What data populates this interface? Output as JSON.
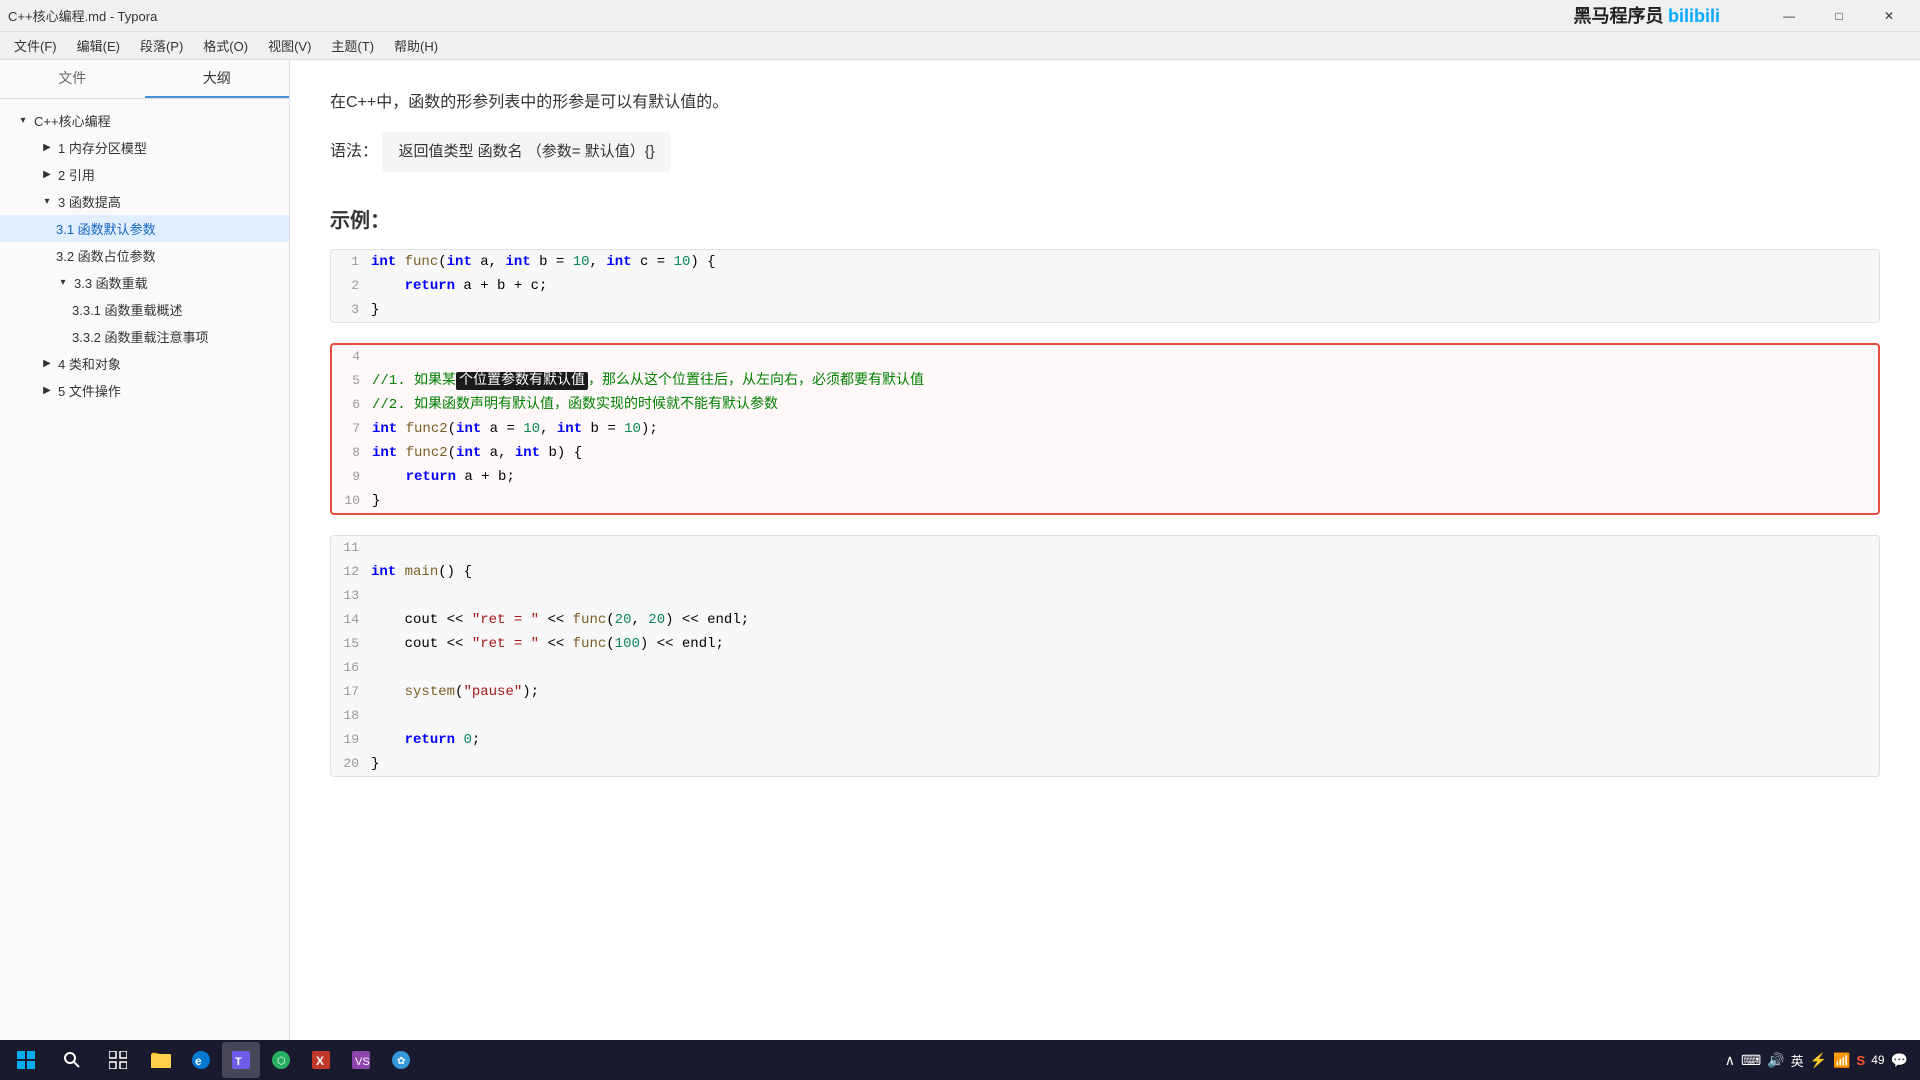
{
  "titleBar": {
    "title": "C++核心编程.md - Typora",
    "minimizeLabel": "—",
    "maximizeLabel": "□",
    "closeLabel": "✕"
  },
  "menuBar": {
    "items": [
      {
        "id": "file",
        "label": "文件(F)"
      },
      {
        "id": "edit",
        "label": "编辑(E)"
      },
      {
        "id": "paragraph",
        "label": "段落(P)"
      },
      {
        "id": "format",
        "label": "格式(O)"
      },
      {
        "id": "view",
        "label": "视图(V)"
      },
      {
        "id": "theme",
        "label": "主题(T)"
      },
      {
        "id": "help",
        "label": "帮助(H)"
      }
    ]
  },
  "sidebar": {
    "tabs": [
      {
        "id": "files",
        "label": "文件"
      },
      {
        "id": "outline",
        "label": "大纲",
        "active": true
      }
    ],
    "items": [
      {
        "id": "root",
        "label": "C++核心编程",
        "level": 0,
        "expanded": true,
        "arrow": "▾"
      },
      {
        "id": "s1",
        "label": "1 内存分区模型",
        "level": 1,
        "expanded": false,
        "arrow": "▶"
      },
      {
        "id": "s2",
        "label": "2 引用",
        "level": 1,
        "expanded": false,
        "arrow": "▶"
      },
      {
        "id": "s3",
        "label": "3 函数提高",
        "level": 1,
        "expanded": true,
        "arrow": "▾"
      },
      {
        "id": "s31",
        "label": "3.1 函数默认参数",
        "level": 2,
        "active": true
      },
      {
        "id": "s32",
        "label": "3.2 函数占位参数",
        "level": 2
      },
      {
        "id": "s33",
        "label": "3.3 函数重载",
        "level": 2,
        "expanded": true,
        "arrow": "▾"
      },
      {
        "id": "s331",
        "label": "3.3.1 函数重载概述",
        "level": 3
      },
      {
        "id": "s332",
        "label": "3.3.2 函数重载注意事项",
        "level": 3
      },
      {
        "id": "s4",
        "label": "4 类和对象",
        "level": 1,
        "expanded": false,
        "arrow": "▶"
      },
      {
        "id": "s5",
        "label": "5 文件操作",
        "level": 1,
        "expanded": false,
        "arrow": "▶"
      }
    ]
  },
  "content": {
    "intro": "在C++中，函数的形参列表中的形参是可以有默认值的。",
    "syntaxLabel": "语法：",
    "syntax": "返回值类型  函数名  （参数=  默认值）{}",
    "exampleTitle": "示例：",
    "codeBlock1": {
      "lines": [
        {
          "num": 1,
          "text": "int func(int a, int b = 10, int c = 10) {"
        },
        {
          "num": 2,
          "text": "    return a + b + c;"
        },
        {
          "num": 3,
          "text": "}"
        }
      ]
    },
    "codeBlock2": {
      "highlighted": true,
      "lines": [
        {
          "num": 4,
          "text": ""
        },
        {
          "num": 5,
          "text": "//1. 如果某个位置参数有默认值，那么从这个位置往后，从左向右，必须都要有默认值"
        },
        {
          "num": 6,
          "text": "//2. 如果函数声明有默认值，函数实现的时候就不能有默认参数"
        },
        {
          "num": 7,
          "text": "int func2(int a = 10, int b = 10);"
        },
        {
          "num": 8,
          "text": "int func2(int a, int b) {"
        },
        {
          "num": 9,
          "text": "    return a + b;"
        },
        {
          "num": 10,
          "text": "}"
        }
      ]
    },
    "codeBlock3": {
      "lines": [
        {
          "num": 11,
          "text": ""
        },
        {
          "num": 12,
          "text": "int main() {"
        },
        {
          "num": 13,
          "text": ""
        },
        {
          "num": 14,
          "text": "    cout << \"ret = \" << func(20, 20) << endl;"
        },
        {
          "num": 15,
          "text": "    cout << \"ret = \" << func(100) << endl;"
        },
        {
          "num": 16,
          "text": ""
        },
        {
          "num": 17,
          "text": "    system(\"pause\");"
        },
        {
          "num": 18,
          "text": ""
        },
        {
          "num": 19,
          "text": "    return 0;"
        },
        {
          "num": 20,
          "text": "}"
        }
      ]
    }
  },
  "taskbar": {
    "sysIcons": "英  ∧  🔊  英  49  🗪"
  }
}
